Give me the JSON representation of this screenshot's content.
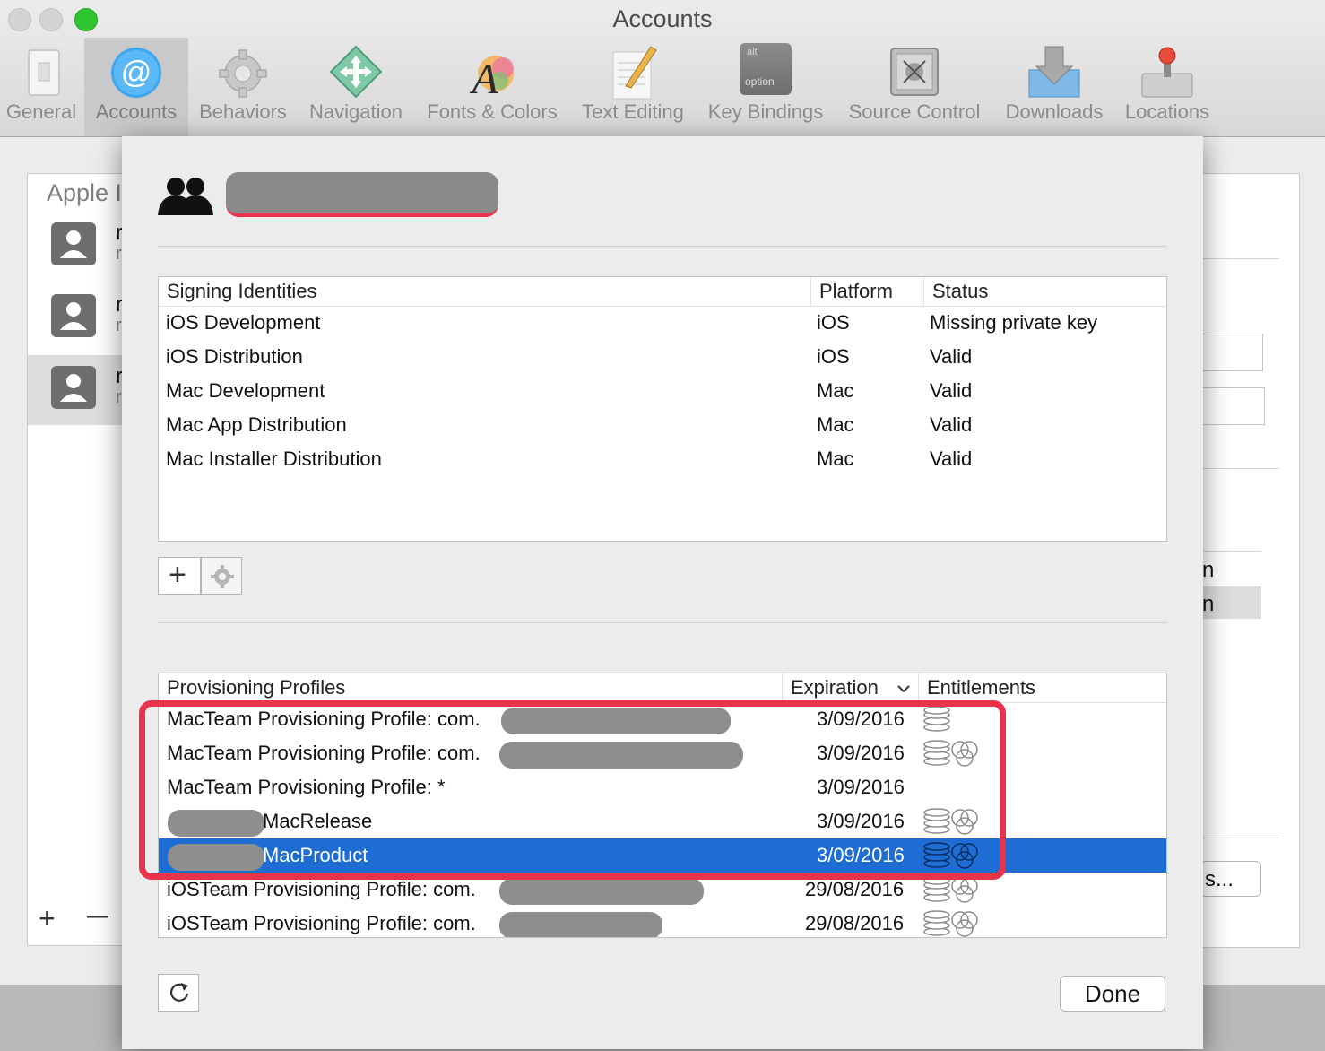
{
  "window": {
    "title": "Accounts"
  },
  "toolbar": {
    "items": [
      {
        "label": "General",
        "icon": "general-switch-icon"
      },
      {
        "label": "Accounts",
        "icon": "at-sign-icon",
        "active": true
      },
      {
        "label": "Behaviors",
        "icon": "gear-icon"
      },
      {
        "label": "Navigation",
        "icon": "navigation-arrows-icon"
      },
      {
        "label": "Fonts & Colors",
        "icon": "fonts-colors-icon"
      },
      {
        "label": "Text Editing",
        "icon": "pencil-paper-icon"
      },
      {
        "label": "Key Bindings",
        "icon": "option-key-icon"
      },
      {
        "label": "Source Control",
        "icon": "vault-icon"
      },
      {
        "label": "Downloads",
        "icon": "download-box-icon"
      },
      {
        "label": "Locations",
        "icon": "joystick-drive-icon"
      }
    ],
    "key_alt": "alt",
    "key_option": "option"
  },
  "accounts_list": {
    "header": "Apple I",
    "plus": "+",
    "minus": "—",
    "rows": [
      {
        "line1": "r",
        "line2": "r"
      },
      {
        "line1": "r",
        "line2": "r"
      },
      {
        "line1": "r",
        "line2": "r"
      }
    ]
  },
  "right_panel": {
    "row1": "n",
    "row2": "n",
    "button": "s..."
  },
  "sheet": {
    "team_icon": "team-people-icon",
    "signing": {
      "columns": [
        "Signing Identities",
        "Platform",
        "Status"
      ],
      "rows": [
        {
          "name": "iOS Development",
          "platform": "iOS",
          "status": "Missing private key"
        },
        {
          "name": "iOS Distribution",
          "platform": "iOS",
          "status": "Valid"
        },
        {
          "name": "Mac Development",
          "platform": "Mac",
          "status": "Valid"
        },
        {
          "name": "Mac App Distribution",
          "platform": "Mac",
          "status": "Valid"
        },
        {
          "name": "Mac Installer Distribution",
          "platform": "Mac",
          "status": "Valid"
        }
      ]
    },
    "add_label": "+",
    "profiles": {
      "columns": [
        "Provisioning Profiles",
        "Expiration",
        "Entitlements"
      ],
      "rows": [
        {
          "name": "MacTeam Provisioning Profile: com.",
          "expiration": "3/09/2016",
          "icons": "single"
        },
        {
          "name": "MacTeam Provisioning Profile: com.",
          "expiration": "3/09/2016",
          "icons": "double"
        },
        {
          "name": "MacTeam Provisioning Profile: *",
          "expiration": "3/09/2016",
          "icons": "none"
        },
        {
          "name": "MacRelease",
          "expiration": "3/09/2016",
          "icons": "double"
        },
        {
          "name": "MacProduct",
          "expiration": "3/09/2016",
          "icons": "double",
          "selected": true
        },
        {
          "name": "iOSTeam Provisioning Profile: com.",
          "expiration": "29/08/2016",
          "icons": "double"
        },
        {
          "name": "iOSTeam Provisioning Profile: com.",
          "expiration": "29/08/2016",
          "icons": "double"
        }
      ]
    },
    "done_label": "Done"
  },
  "colors": {
    "selection": "#1d6dd5",
    "highlight_box": "#e8334a",
    "close": "#d0d0d0",
    "zoom": "#2ec52f"
  }
}
